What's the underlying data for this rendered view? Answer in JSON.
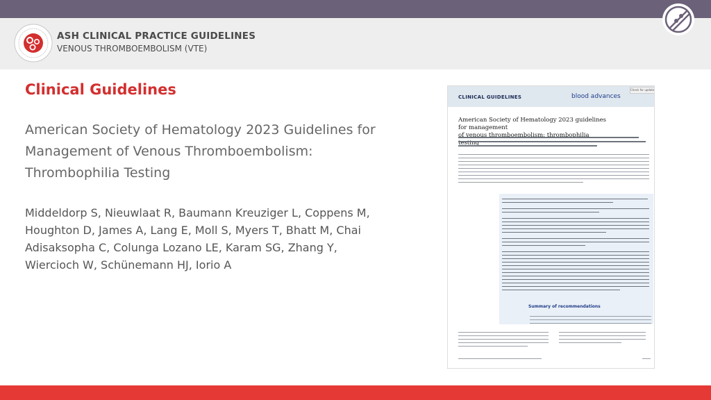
{
  "header": {
    "logo_text": "AMERICAN SOCIETY OF HEMATOLOGY",
    "title": "ASH CLINICAL PRACTICE GUIDELINES",
    "subtitle": "VENOUS THROMBOEMBOLISM (VTE)"
  },
  "slide": {
    "section_title": "Clinical Guidelines",
    "guideline_title_lines": [
      "American Society of Hematology 2023 Guidelines for",
      "Management of Venous Thromboembolism:",
      "Thrombophilia Testing"
    ],
    "authors_lines": [
      "Middeldorp S, Nieuwlaat R, Baumann Kreuziger L, Coppens M,",
      "Houghton D, James A, Lang E, Moll S, Myers T, Bhatt M, Chai",
      "Adisaksopha C, Colunga Lozano LE, Karam SG, Zhang Y,",
      "Wiercioch W, Schünemann HJ, Iorio A"
    ]
  },
  "paper": {
    "section_label": "CLINICAL GUIDELINES",
    "brand": "blood advances",
    "check_updates": "Check for updates",
    "title_lines": [
      "American Society of Hematology 2023 guidelines for management",
      "of venous thromboembolism: thrombophilia testing"
    ],
    "summary_heading": "Summary of recommendations"
  },
  "colors": {
    "top_bar": "#6b6178",
    "header_bg": "#eeeeee",
    "accent_red": "#d32f2f",
    "footer_red": "#e53935",
    "journal_blue": "#1f3c88"
  }
}
